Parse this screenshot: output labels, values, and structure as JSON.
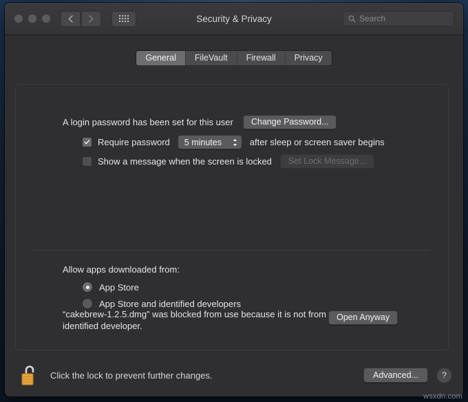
{
  "window": {
    "title": "Security & Privacy",
    "traffic_lights": [
      "close",
      "minimize",
      "zoom"
    ],
    "nav": {
      "back": "‹",
      "forward": "›"
    },
    "show_all_icon": "grid-icon"
  },
  "search": {
    "placeholder": "Search",
    "value": "",
    "icon": "search-icon"
  },
  "tabs": [
    {
      "label": "General",
      "active": true
    },
    {
      "label": "FileVault",
      "active": false
    },
    {
      "label": "Firewall",
      "active": false
    },
    {
      "label": "Privacy",
      "active": false
    }
  ],
  "login_password": {
    "status_text": "A login password has been set for this user",
    "change_button": "Change Password..."
  },
  "require_password": {
    "checked": true,
    "label": "Require password",
    "delay_value": "5 minutes",
    "suffix_label": "after sleep or screen saver begins"
  },
  "lock_message": {
    "checked": false,
    "label": "Show a message when the screen is locked",
    "button_label": "Set Lock Message...",
    "button_disabled": true
  },
  "allow_apps": {
    "heading": "Allow apps downloaded from:",
    "options": [
      {
        "label": "App Store",
        "selected": true
      },
      {
        "label": "App Store and identified developers",
        "selected": false
      }
    ]
  },
  "blocked_app": {
    "message": "“cakebrew-1.2.5.dmg” was blocked from use because it is not from an identified developer.",
    "open_anyway_button": "Open Anyway"
  },
  "footer": {
    "lock_icon": "unlocked-padlock-icon",
    "lock_text": "Click the lock to prevent further changes.",
    "advanced_button": "Advanced...",
    "help_button": "?"
  },
  "watermark": "wsxdn.com",
  "colors": {
    "window_bg": "#2f2f31",
    "titlebar_bg": "#3a3a3c",
    "accent_lock": "#e8a33d",
    "text_primary": "#e4e4e6",
    "tab_active_bg": "#6d6d6f"
  }
}
